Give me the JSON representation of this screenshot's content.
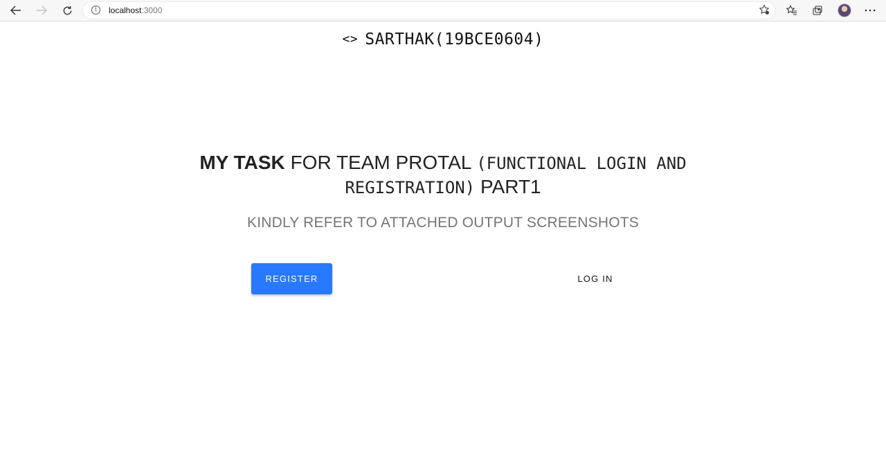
{
  "browser": {
    "url_host": "localhost",
    "url_port": ":3000",
    "icons": [
      "back-arrow-icon",
      "forward-arrow-icon",
      "refresh-icon",
      "site-info-icon",
      "add-favorite-icon",
      "favorites-icon",
      "collections-icon",
      "profile-avatar",
      "more-menu-icon"
    ]
  },
  "header": {
    "code_icon": "<>",
    "title": "SARTHAK(19BCE0604)"
  },
  "hero": {
    "title_strong": "MY TASK",
    "title_normal": "FOR TEAM PROTAL",
    "title_mono": "(FUNCTIONAL LOGIN AND REGISTRATION)",
    "title_suffix": "PART1",
    "subtitle": "KINDLY REFER TO ATTACHED OUTPUT SCREENSHOTS"
  },
  "actions": {
    "register_label": "REGISTER",
    "login_label": "LOG IN"
  },
  "colors": {
    "primary": "#2979ff",
    "subtitle": "#757575"
  }
}
